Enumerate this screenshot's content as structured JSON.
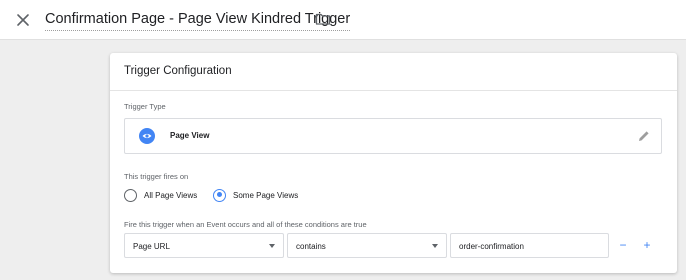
{
  "header": {
    "title": "Confirmation Page - Page View Kindred Trigger",
    "close_icon": "close-icon",
    "folder_icon": "folder-icon"
  },
  "card": {
    "title": "Trigger Configuration",
    "trigger_type_label": "Trigger Type",
    "trigger_type": {
      "name": "Page View",
      "icon": "eye-icon",
      "edit_icon": "pencil-icon"
    },
    "fires_on_label": "This trigger fires on",
    "fires_on_options": [
      {
        "label": "All Page Views",
        "selected": false
      },
      {
        "label": "Some Page Views",
        "selected": true
      }
    ],
    "condition_label": "Fire this trigger when an Event occurs and all of these conditions are true",
    "condition": {
      "variable": "Page URL",
      "operator": "contains",
      "value": "order-confirmation",
      "remove_label": "−",
      "add_label": "+"
    }
  },
  "colors": {
    "accent": "#4285f4",
    "background": "#eeeeee"
  }
}
